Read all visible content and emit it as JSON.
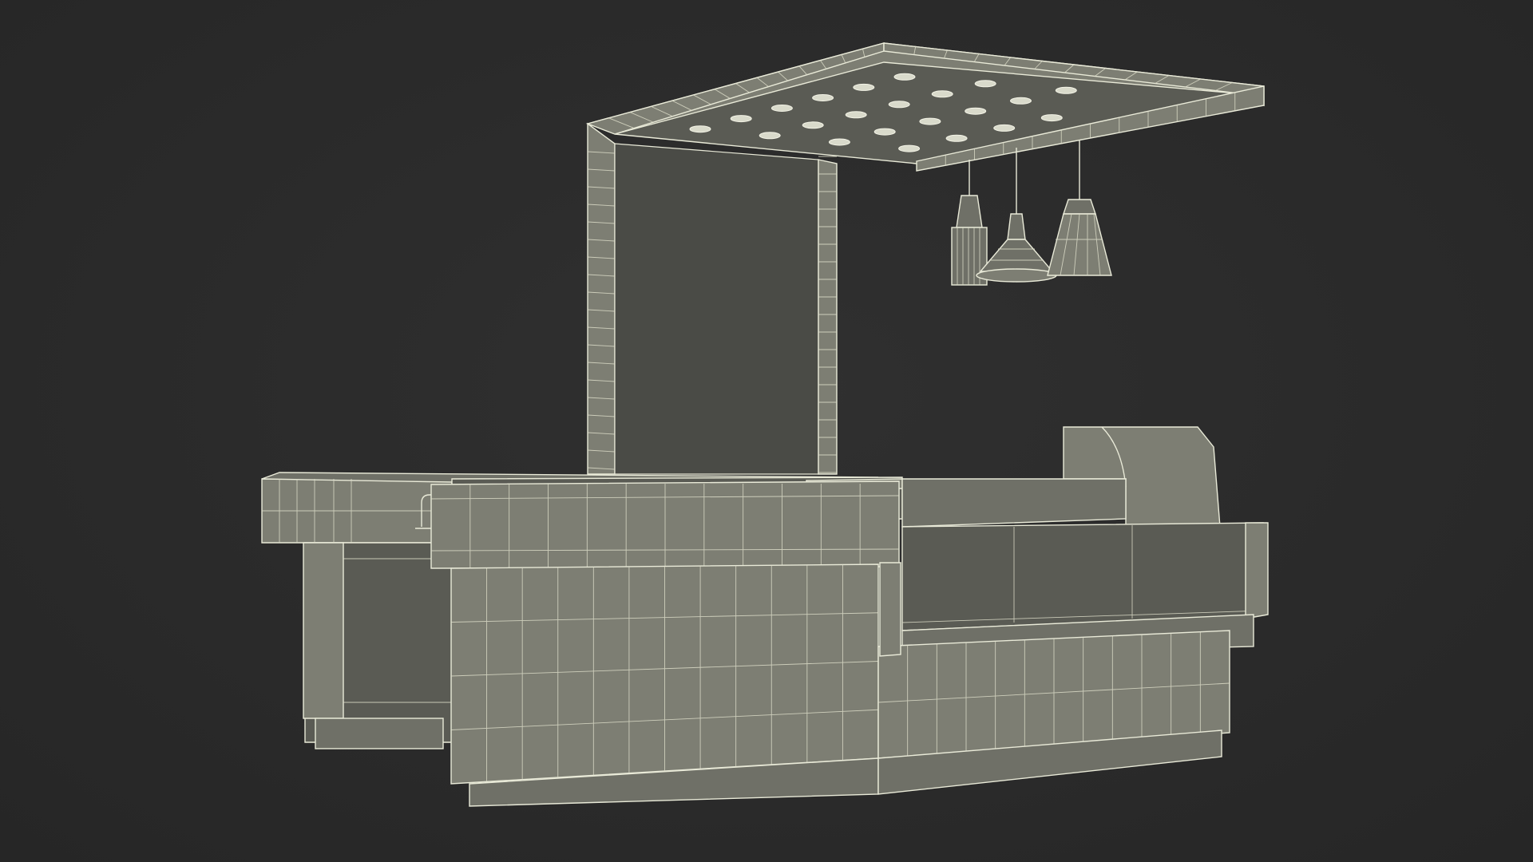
{
  "scene": {
    "background_color": "#2b2b2b",
    "wire_color": "#e9ead8",
    "surface_color": "#7d7e73",
    "panel_color": "#5a5b54"
  },
  "objects": {
    "canopy_ceiling_lights": 22,
    "pendant_lamps": 3,
    "counter_front_columns": 11
  }
}
